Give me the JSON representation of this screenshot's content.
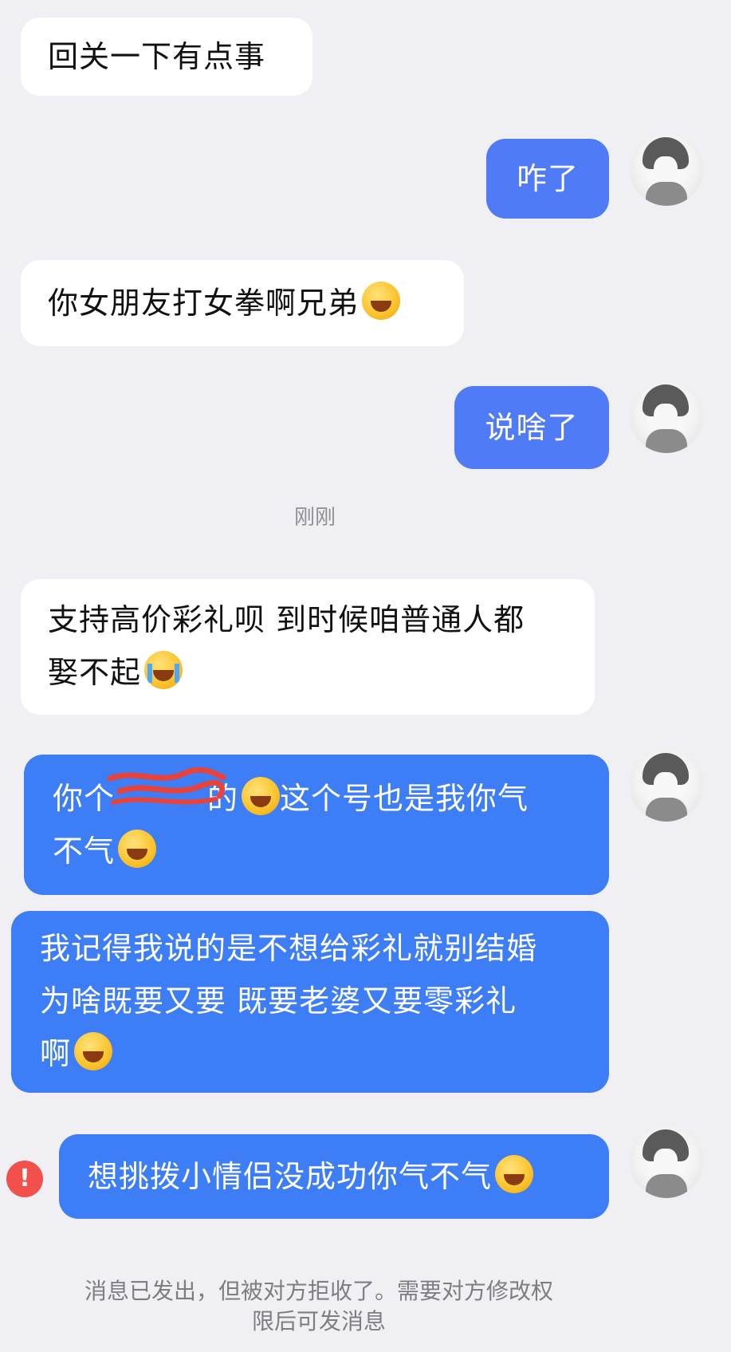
{
  "messages": [
    {
      "side": "in",
      "text": "回关一下有点事"
    },
    {
      "side": "out",
      "text": "咋了"
    },
    {
      "side": "in",
      "text": "你女朋友打女拳啊兄弟"
    },
    {
      "side": "out",
      "text": "说啥了"
    },
    {
      "side": "in",
      "line1": "支持高价彩礼呗 到时候咱普通人都",
      "line2": "娶不起"
    },
    {
      "side": "out",
      "line1_a": "你个",
      "line1_b": "的",
      "line1_c": "这个号也是我你气",
      "line2": "不气"
    },
    {
      "side": "out",
      "line1": "我记得我说的是不想给彩礼就别结婚",
      "line2": "为啥既要又要 既要老婆又要零彩礼",
      "line3": "啊"
    },
    {
      "side": "out",
      "text": "想挑拨小情侣没成功你气不气",
      "status": "failed"
    }
  ],
  "timestamp": "刚刚",
  "warning_glyph": "!",
  "footer": {
    "line1": "消息已发出，但被对方拒收了。需要对方修改权",
    "line2": "限后可发消息"
  },
  "colors": {
    "background": "#efeff4",
    "incoming_bubble": "#ffffff",
    "outgoing_bubble": "#4f7bf7",
    "warning": "#f2504a"
  },
  "icons": [
    "laugh-cry-emoji",
    "crying-emoji",
    "avatar-image",
    "warning-icon"
  ]
}
